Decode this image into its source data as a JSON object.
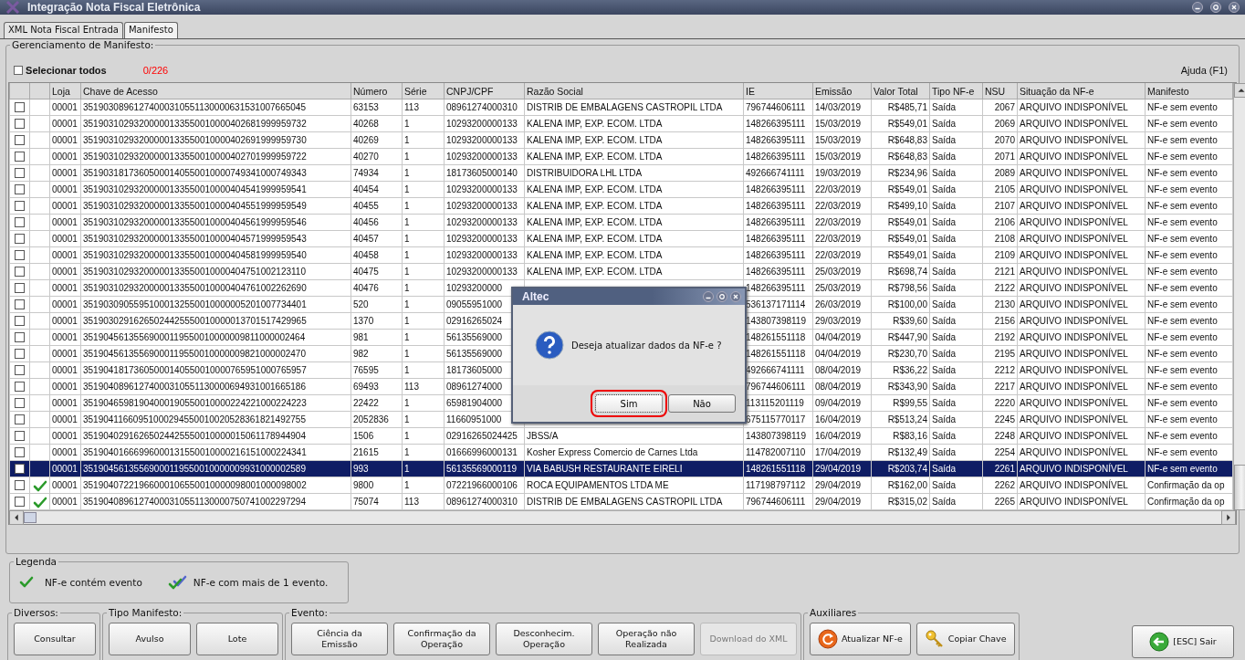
{
  "window": {
    "title": "Integração Nota Fiscal Eletrônica"
  },
  "tabs": [
    {
      "label": "XML Nota Fiscal Entrada",
      "selected": false
    },
    {
      "label": "Manifesto",
      "selected": true
    }
  ],
  "panel": {
    "title": "Gerenciamento de Manifesto:",
    "select_all": {
      "label": "Selecionar todos",
      "checked": false
    },
    "count": "0/226",
    "help": "Ajuda (F1)"
  },
  "table": {
    "columns": [
      "Loja",
      "Chave de Acesso",
      "Número",
      "Série",
      "CNPJ/CPF",
      "Razão Social",
      "IE",
      "Emissão",
      "Valor Total",
      "Tipo NF-e",
      "NSU",
      "Situação da NF-e",
      "Manifesto"
    ],
    "rows": [
      {
        "checked": false,
        "has_event": false,
        "selected": false,
        "loja": "00001",
        "chave": "35190308961274000310551130000631531007665045",
        "numero": "63153",
        "serie": "113",
        "cnpj": "08961274000310",
        "razao": "DISTRIB DE EMBALAGENS CASTROPIL LTDA",
        "ie": "796744606111",
        "emissao": "14/03/2019",
        "valor": "R$485,71",
        "tipo": "Saída",
        "nsu": "2067",
        "situacao": "ARQUIVO INDISPONÍVEL",
        "manifesto": "NF-e sem evento"
      },
      {
        "checked": false,
        "has_event": false,
        "selected": false,
        "loja": "00001",
        "chave": "35190310293200000133550010000402681999959732",
        "numero": "40268",
        "serie": "1",
        "cnpj": "10293200000133",
        "razao": "KALENA IMP, EXP. ECOM. LTDA",
        "ie": "148266395111",
        "emissao": "15/03/2019",
        "valor": "R$549,01",
        "tipo": "Saída",
        "nsu": "2069",
        "situacao": "ARQUIVO INDISPONÍVEL",
        "manifesto": "NF-e sem evento"
      },
      {
        "checked": false,
        "has_event": false,
        "selected": false,
        "loja": "00001",
        "chave": "35190310293200000133550010000402691999959730",
        "numero": "40269",
        "serie": "1",
        "cnpj": "10293200000133",
        "razao": "KALENA IMP, EXP. ECOM. LTDA",
        "ie": "148266395111",
        "emissao": "15/03/2019",
        "valor": "R$648,83",
        "tipo": "Saída",
        "nsu": "2070",
        "situacao": "ARQUIVO INDISPONÍVEL",
        "manifesto": "NF-e sem evento"
      },
      {
        "checked": false,
        "has_event": false,
        "selected": false,
        "loja": "00001",
        "chave": "35190310293200000133550010000402701999959722",
        "numero": "40270",
        "serie": "1",
        "cnpj": "10293200000133",
        "razao": "KALENA IMP, EXP. ECOM. LTDA",
        "ie": "148266395111",
        "emissao": "15/03/2019",
        "valor": "R$648,83",
        "tipo": "Saída",
        "nsu": "2071",
        "situacao": "ARQUIVO INDISPONÍVEL",
        "manifesto": "NF-e sem evento"
      },
      {
        "checked": false,
        "has_event": false,
        "selected": false,
        "loja": "00001",
        "chave": "35190318173605000140550010000749341000749343",
        "numero": "74934",
        "serie": "1",
        "cnpj": "18173605000140",
        "razao": "DISTRIBUIDORA LHL LTDA",
        "ie": "492666741111",
        "emissao": "19/03/2019",
        "valor": "R$234,96",
        "tipo": "Saída",
        "nsu": "2089",
        "situacao": "ARQUIVO INDISPONÍVEL",
        "manifesto": "NF-e sem evento"
      },
      {
        "checked": false,
        "has_event": false,
        "selected": false,
        "loja": "00001",
        "chave": "35190310293200000133550010000404541999959541",
        "numero": "40454",
        "serie": "1",
        "cnpj": "10293200000133",
        "razao": "KALENA IMP, EXP. ECOM. LTDA",
        "ie": "148266395111",
        "emissao": "22/03/2019",
        "valor": "R$549,01",
        "tipo": "Saída",
        "nsu": "2105",
        "situacao": "ARQUIVO INDISPONÍVEL",
        "manifesto": "NF-e sem evento"
      },
      {
        "checked": false,
        "has_event": false,
        "selected": false,
        "loja": "00001",
        "chave": "35190310293200000133550010000404551999959549",
        "numero": "40455",
        "serie": "1",
        "cnpj": "10293200000133",
        "razao": "KALENA IMP, EXP. ECOM. LTDA",
        "ie": "148266395111",
        "emissao": "22/03/2019",
        "valor": "R$499,10",
        "tipo": "Saída",
        "nsu": "2107",
        "situacao": "ARQUIVO INDISPONÍVEL",
        "manifesto": "NF-e sem evento"
      },
      {
        "checked": false,
        "has_event": false,
        "selected": false,
        "loja": "00001",
        "chave": "35190310293200000133550010000404561999959546",
        "numero": "40456",
        "serie": "1",
        "cnpj": "10293200000133",
        "razao": "KALENA IMP, EXP. ECOM. LTDA",
        "ie": "148266395111",
        "emissao": "22/03/2019",
        "valor": "R$549,01",
        "tipo": "Saída",
        "nsu": "2106",
        "situacao": "ARQUIVO INDISPONÍVEL",
        "manifesto": "NF-e sem evento"
      },
      {
        "checked": false,
        "has_event": false,
        "selected": false,
        "loja": "00001",
        "chave": "35190310293200000133550010000404571999959543",
        "numero": "40457",
        "serie": "1",
        "cnpj": "10293200000133",
        "razao": "KALENA IMP, EXP. ECOM. LTDA",
        "ie": "148266395111",
        "emissao": "22/03/2019",
        "valor": "R$549,01",
        "tipo": "Saída",
        "nsu": "2108",
        "situacao": "ARQUIVO INDISPONÍVEL",
        "manifesto": "NF-e sem evento"
      },
      {
        "checked": false,
        "has_event": false,
        "selected": false,
        "loja": "00001",
        "chave": "35190310293200000133550010000404581999959540",
        "numero": "40458",
        "serie": "1",
        "cnpj": "10293200000133",
        "razao": "KALENA IMP, EXP. ECOM. LTDA",
        "ie": "148266395111",
        "emissao": "22/03/2019",
        "valor": "R$549,01",
        "tipo": "Saída",
        "nsu": "2109",
        "situacao": "ARQUIVO INDISPONÍVEL",
        "manifesto": "NF-e sem evento"
      },
      {
        "checked": false,
        "has_event": false,
        "selected": false,
        "loja": "00001",
        "chave": "35190310293200000133550010000404751002123110",
        "numero": "40475",
        "serie": "1",
        "cnpj": "10293200000133",
        "razao": "KALENA IMP, EXP. ECOM. LTDA",
        "ie": "148266395111",
        "emissao": "25/03/2019",
        "valor": "R$698,74",
        "tipo": "Saída",
        "nsu": "2121",
        "situacao": "ARQUIVO INDISPONÍVEL",
        "manifesto": "NF-e sem evento"
      },
      {
        "checked": false,
        "has_event": false,
        "selected": false,
        "loja": "00001",
        "chave": "35190310293200000133550010000404761002262690",
        "numero": "40476",
        "serie": "1",
        "cnpj": "10293200000",
        "ie": "148266395111",
        "emissao": "25/03/2019",
        "valor": "R$798,56",
        "tipo": "Saída",
        "nsu": "2122",
        "situacao": "ARQUIVO INDISPONÍVEL",
        "manifesto": "NF-e sem evento"
      },
      {
        "checked": false,
        "has_event": false,
        "selected": false,
        "loja": "00001",
        "chave": "35190309055951000132550010000005201007734401",
        "numero": "520",
        "serie": "1",
        "cnpj": "09055951000",
        "ie": "536137171114",
        "emissao": "26/03/2019",
        "valor": "R$100,00",
        "tipo": "Saída",
        "nsu": "2130",
        "situacao": "ARQUIVO INDISPONÍVEL",
        "manifesto": "NF-e sem evento"
      },
      {
        "checked": false,
        "has_event": false,
        "selected": false,
        "loja": "00001",
        "chave": "35190302916265024425550010000013701517429965",
        "numero": "1370",
        "serie": "1",
        "cnpj": "02916265024",
        "ie": "143807398119",
        "emissao": "29/03/2019",
        "valor": "R$39,60",
        "tipo": "Saída",
        "nsu": "2156",
        "situacao": "ARQUIVO INDISPONÍVEL",
        "manifesto": "NF-e sem evento"
      },
      {
        "checked": false,
        "has_event": false,
        "selected": false,
        "loja": "00001",
        "chave": "35190456135569000119550010000009811000002464",
        "numero": "981",
        "serie": "1",
        "cnpj": "56135569000",
        "ie": "148261551118",
        "emissao": "04/04/2019",
        "valor": "R$447,90",
        "tipo": "Saída",
        "nsu": "2192",
        "situacao": "ARQUIVO INDISPONÍVEL",
        "manifesto": "NF-e sem evento"
      },
      {
        "checked": false,
        "has_event": false,
        "selected": false,
        "loja": "00001",
        "chave": "35190456135569000119550010000009821000002470",
        "numero": "982",
        "serie": "1",
        "cnpj": "56135569000",
        "ie": "148261551118",
        "emissao": "04/04/2019",
        "valor": "R$230,70",
        "tipo": "Saída",
        "nsu": "2195",
        "situacao": "ARQUIVO INDISPONÍVEL",
        "manifesto": "NF-e sem evento"
      },
      {
        "checked": false,
        "has_event": false,
        "selected": false,
        "loja": "00001",
        "chave": "35190418173605000140550010000765951000765957",
        "numero": "76595",
        "serie": "1",
        "cnpj": "18173605000",
        "ie": "492666741111",
        "emissao": "08/04/2019",
        "valor": "R$36,22",
        "tipo": "Saída",
        "nsu": "2212",
        "situacao": "ARQUIVO INDISPONÍVEL",
        "manifesto": "NF-e sem evento"
      },
      {
        "checked": false,
        "has_event": false,
        "selected": false,
        "loja": "00001",
        "chave": "35190408961274000310551130000694931001665186",
        "numero": "69493",
        "serie": "113",
        "cnpj": "08961274000",
        "ie": "796744606111",
        "emissao": "08/04/2019",
        "valor": "R$343,90",
        "tipo": "Saída",
        "nsu": "2217",
        "situacao": "ARQUIVO INDISPONÍVEL",
        "manifesto": "NF-e sem evento"
      },
      {
        "checked": false,
        "has_event": false,
        "selected": false,
        "loja": "00001",
        "chave": "35190465981904000190550010000224221000224223",
        "numero": "22422",
        "serie": "1",
        "cnpj": "65981904000",
        "ie": "113115201119",
        "emissao": "09/04/2019",
        "valor": "R$99,55",
        "tipo": "Saída",
        "nsu": "2220",
        "situacao": "ARQUIVO INDISPONÍVEL",
        "manifesto": "NF-e sem evento"
      },
      {
        "checked": false,
        "has_event": false,
        "selected": false,
        "loja": "00001",
        "chave": "35190411660951000294550010020528361821492755",
        "numero": "2052836",
        "serie": "1",
        "cnpj": "11660951000",
        "ie": "675115770117",
        "emissao": "16/04/2019",
        "valor": "R$513,24",
        "tipo": "Saída",
        "nsu": "2245",
        "situacao": "ARQUIVO INDISPONÍVEL",
        "manifesto": "NF-e sem evento"
      },
      {
        "checked": false,
        "has_event": false,
        "selected": false,
        "loja": "00001",
        "chave": "35190402916265024425550010000015061178944904",
        "numero": "1506",
        "serie": "1",
        "cnpj": "02916265024425",
        "razao": "JBSS/A",
        "ie": "143807398119",
        "emissao": "16/04/2019",
        "valor": "R$83,16",
        "tipo": "Saída",
        "nsu": "2248",
        "situacao": "ARQUIVO INDISPONÍVEL",
        "manifesto": "NF-e sem evento"
      },
      {
        "checked": false,
        "has_event": false,
        "selected": false,
        "loja": "00001",
        "chave": "35190401666996000131550010000216151000224341",
        "numero": "21615",
        "serie": "1",
        "cnpj": "01666996000131",
        "razao": "Kosher Express Comercio de Carnes Ltda",
        "ie": "114782007110",
        "emissao": "17/04/2019",
        "valor": "R$132,49",
        "tipo": "Saída",
        "nsu": "2254",
        "situacao": "ARQUIVO INDISPONÍVEL",
        "manifesto": "NF-e sem evento"
      },
      {
        "checked": false,
        "has_event": false,
        "selected": true,
        "loja": "00001",
        "chave": "35190456135569000119550010000009931000002589",
        "numero": "993",
        "serie": "1",
        "cnpj": "56135569000119",
        "razao": "VIA BABUSH RESTAURANTE EIRELI",
        "ie": "148261551118",
        "emissao": "29/04/2019",
        "valor": "R$203,74",
        "tipo": "Saída",
        "nsu": "2261",
        "situacao": "ARQUIVO INDISPONÍVEL",
        "manifesto": "NF-e sem evento"
      },
      {
        "checked": false,
        "has_event": true,
        "selected": false,
        "loja": "00001",
        "chave": "35190407221966000106550010000098001000098002",
        "numero": "9800",
        "serie": "1",
        "cnpj": "07221966000106",
        "razao": "ROCA EQUIPAMENTOS LTDA ME",
        "ie": "117198797112",
        "emissao": "29/04/2019",
        "valor": "R$162,00",
        "tipo": "Saída",
        "nsu": "2262",
        "situacao": "ARQUIVO INDISPONÍVEL",
        "manifesto": "Confirmação da op"
      },
      {
        "checked": false,
        "has_event": true,
        "selected": false,
        "loja": "00001",
        "chave": "35190408961274000310551130000750741002297294",
        "numero": "75074",
        "serie": "113",
        "cnpj": "08961274000310",
        "razao": "DISTRIB DE EMBALAGENS CASTROPIL LTDA",
        "ie": "796744606111",
        "emissao": "29/04/2019",
        "valor": "R$315,02",
        "tipo": "Saída",
        "nsu": "2265",
        "situacao": "ARQUIVO INDISPONÍVEL",
        "manifesto": "Confirmação da op"
      }
    ]
  },
  "legend": {
    "title": "Legenda",
    "items": [
      {
        "kind": "single",
        "label": "NF-e contém evento"
      },
      {
        "kind": "multiple",
        "label": "NF-e com mais de 1 evento."
      }
    ]
  },
  "groups": [
    {
      "title": "Diversos:",
      "buttons": [
        {
          "label": "Consultar",
          "kind": "plain",
          "disabled": false
        }
      ]
    },
    {
      "title": "Tipo Manifesto:",
      "buttons": [
        {
          "label": "Avulso",
          "kind": "plain",
          "disabled": false
        },
        {
          "label": "Lote",
          "kind": "plain",
          "disabled": false
        }
      ]
    },
    {
      "title": "Evento:",
      "buttons": [
        {
          "label": "Ciência da Emissão",
          "kind": "plain",
          "disabled": false
        },
        {
          "label": "Confirmação da Operação",
          "kind": "plain",
          "disabled": false
        },
        {
          "label": "Desconhecim. Operação",
          "kind": "plain",
          "disabled": false
        },
        {
          "label": "Operação não Realizada",
          "kind": "plain",
          "disabled": false
        },
        {
          "label": "Download do XML",
          "kind": "plain",
          "disabled": true
        }
      ]
    },
    {
      "title": "Auxiliares",
      "buttons": [
        {
          "label": "Atualizar NF-e",
          "kind": "refresh",
          "disabled": false
        },
        {
          "label": "Copiar Chave",
          "kind": "key",
          "disabled": false
        }
      ]
    }
  ],
  "exit_button": {
    "label": "[ESC] Sair"
  },
  "dialog": {
    "title": "Altec",
    "message": "Deseja atualizar dados da NF-e ?",
    "buttons": [
      {
        "label": "Sim",
        "focused": true
      },
      {
        "label": "Não",
        "focused": false
      }
    ]
  }
}
